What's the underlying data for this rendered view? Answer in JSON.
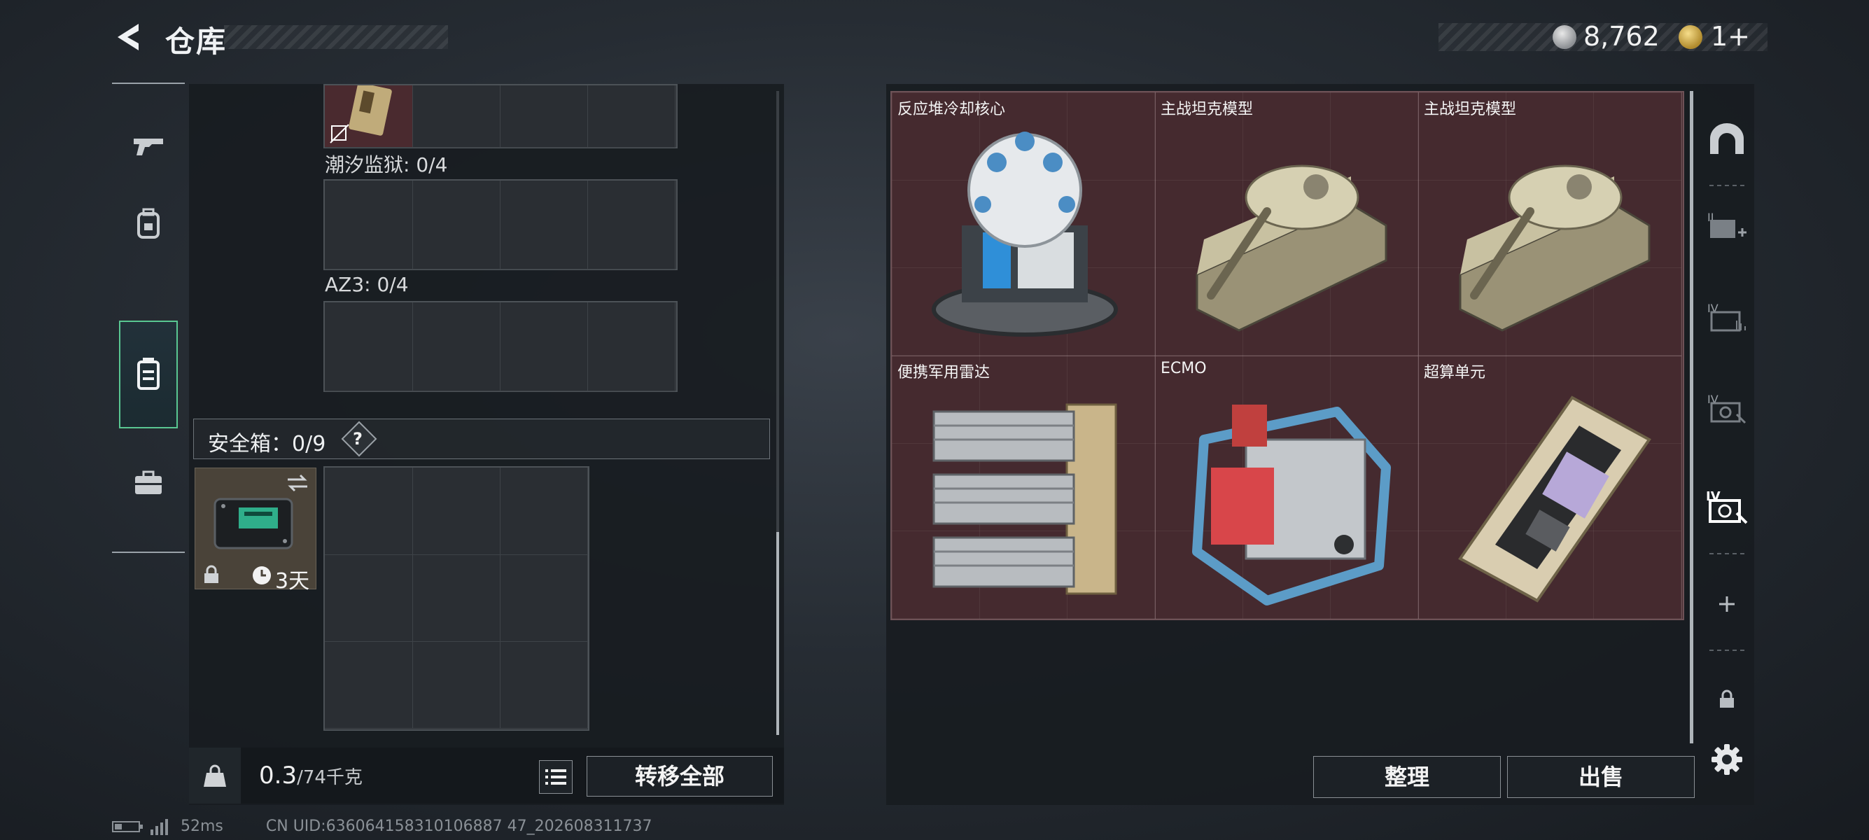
{
  "header": {
    "title": "仓库"
  },
  "currency": [
    {
      "icon": "silver-coin-icon",
      "value": "8,762"
    },
    {
      "icon": "gold-coin-icon",
      "value": "1+"
    }
  ],
  "left_rail": {
    "items": [
      {
        "name": "weapon",
        "icon": "gun-icon"
      },
      {
        "name": "armor",
        "icon": "backpack-icon"
      },
      {
        "name": "container",
        "icon": "container-icon"
      },
      {
        "name": "toolkit",
        "icon": "briefcase-icon"
      }
    ]
  },
  "left_panel": {
    "sections": [
      {
        "label": "潮汐监狱: 0/4"
      },
      {
        "label": "AZ3: 0/4"
      }
    ],
    "safe_box": {
      "title": "安全箱：0/9",
      "help": "?",
      "tile_timer": "3天"
    },
    "footer": {
      "weight_value": "0.3",
      "weight_capacity": "/74千克",
      "transfer_all_label": "转移全部"
    }
  },
  "items": [
    {
      "name": "反应堆冷却核心"
    },
    {
      "name": "主战坦克模型"
    },
    {
      "name": "主战坦克模型"
    },
    {
      "name": "便携军用雷达"
    },
    {
      "name": "ECMO"
    },
    {
      "name": "超算单元"
    }
  ],
  "right_panel": {
    "sort_label": "整理",
    "sell_label": "出售"
  },
  "status": {
    "ping": "52ms",
    "uid": "CN UID:636064158310106887 47_202608311737"
  },
  "colors": {
    "accent_green": "#59c792",
    "item_cell_bg": "#452a2f"
  }
}
